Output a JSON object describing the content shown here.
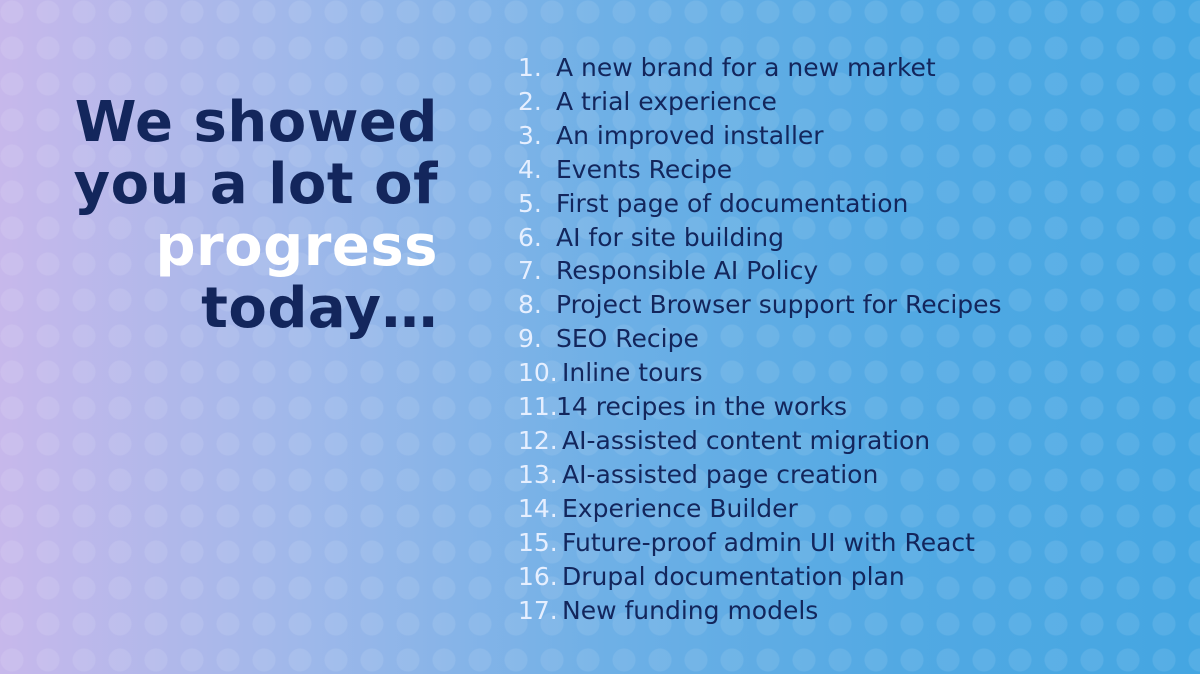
{
  "headline": {
    "line1": "We showed",
    "line2": "you a lot of",
    "line3": "progress",
    "line4": "today…"
  },
  "items": [
    {
      "num": "1.",
      "text": "A new brand for a new market"
    },
    {
      "num": "2.",
      "text": "A trial experience"
    },
    {
      "num": "3.",
      "text": "An improved installer"
    },
    {
      "num": "4.",
      "text": "Events Recipe"
    },
    {
      "num": "5.",
      "text": "First page of documentation"
    },
    {
      "num": "6.",
      "text": "AI for site building"
    },
    {
      "num": "7.",
      "text": "Responsible AI Policy"
    },
    {
      "num": "8.",
      "text": "Project Browser support for Recipes"
    },
    {
      "num": "9.",
      "text": "SEO Recipe"
    },
    {
      "num": "10.",
      "text": "Inline tours"
    },
    {
      "num": "11.",
      "text": "14 recipes in the works"
    },
    {
      "num": "12.",
      "text": "AI-assisted content migration"
    },
    {
      "num": "13.",
      "text": "AI-assisted page creation"
    },
    {
      "num": "14.",
      "text": "Experience Builder"
    },
    {
      "num": "15.",
      "text": "Future-proof admin UI with React"
    },
    {
      "num": "16.",
      "text": "Drupal documentation plan"
    },
    {
      "num": "17.",
      "text": "New funding models"
    }
  ],
  "colors": {
    "text_dark": "#13265c",
    "highlight": "#ffffff",
    "number": "#e6efff"
  }
}
